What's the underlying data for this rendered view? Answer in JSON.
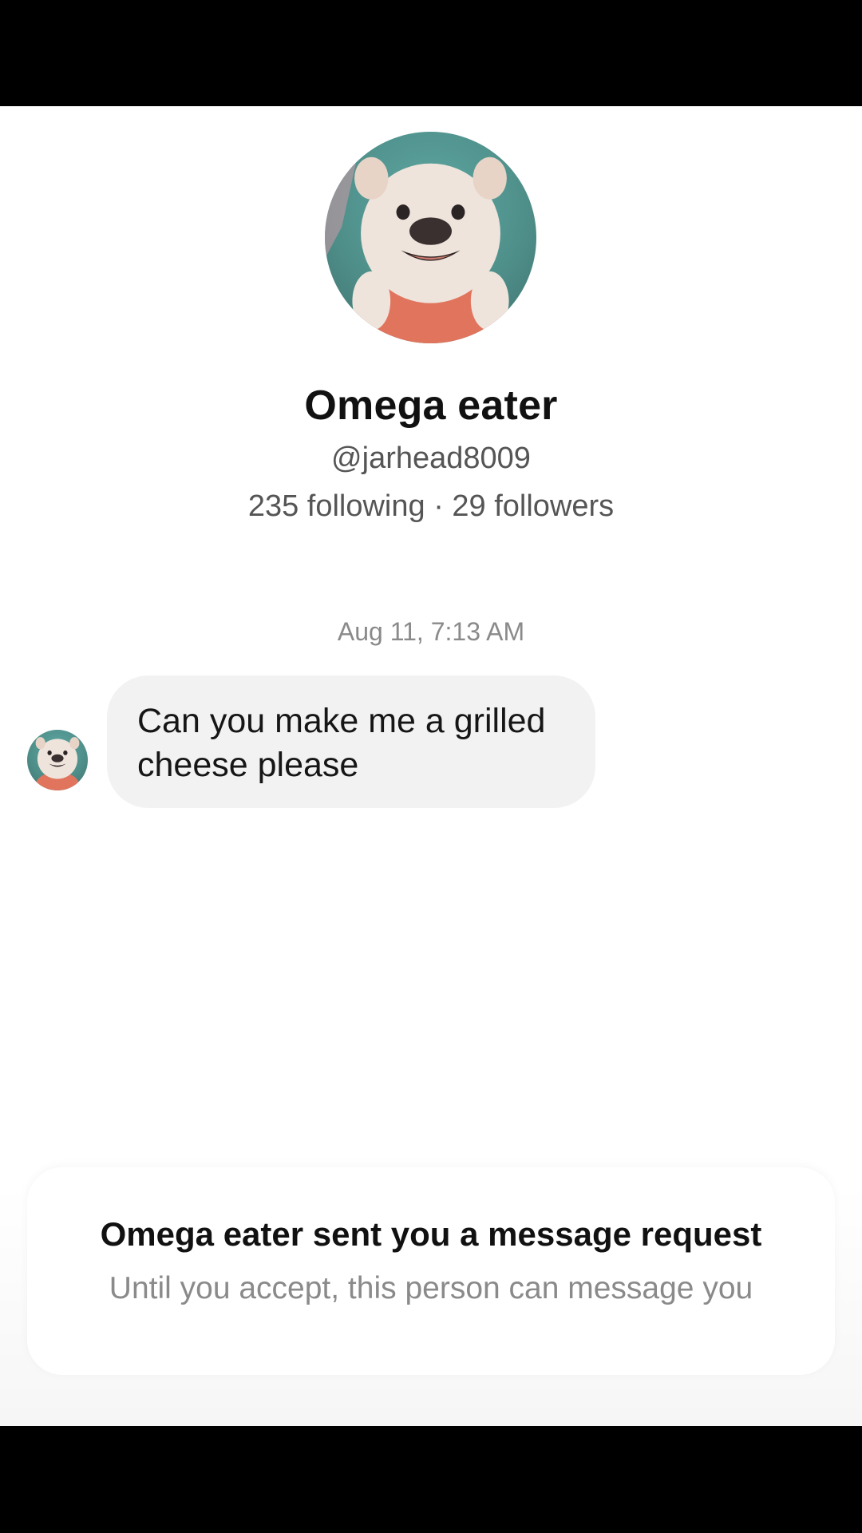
{
  "profile": {
    "name": "Omega eater",
    "handle": "@jarhead8009",
    "stats": "235 following · 29 followers",
    "avatar_icon": "french-bulldog-puppy-photo"
  },
  "conversation": {
    "timestamp": "Aug 11, 7:13 AM",
    "messages": [
      {
        "sender": "Omega eater",
        "text": "Can you make me a grilled cheese please"
      }
    ]
  },
  "request_banner": {
    "title": "Omega eater sent you a message request",
    "description": "Until you accept, this person can message you"
  },
  "colors": {
    "bubble_bg": "#f2f2f2",
    "primary_text": "#111111",
    "secondary_text": "#555555",
    "muted_text": "#8a8a8a"
  }
}
